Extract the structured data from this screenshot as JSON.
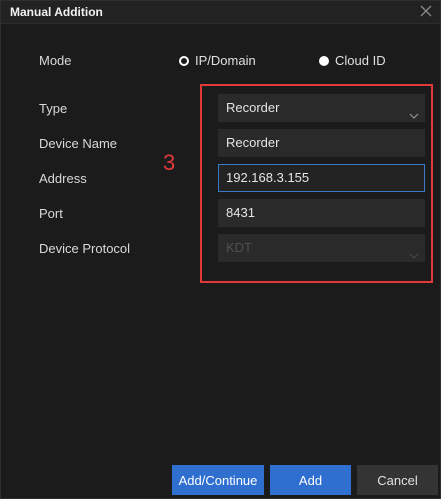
{
  "dialog": {
    "title": "Manual Addition",
    "close_icon": "close-icon"
  },
  "mode": {
    "label": "Mode",
    "options": [
      {
        "label": "IP/Domain",
        "selected": true
      },
      {
        "label": "Cloud ID",
        "selected": false
      }
    ]
  },
  "form": {
    "type": {
      "label": "Type",
      "value": "Recorder"
    },
    "device_name": {
      "label": "Device Name",
      "value": "Recorder"
    },
    "address": {
      "label": "Address",
      "value": "192.168.3.155"
    },
    "port": {
      "label": "Port",
      "value": "8431"
    },
    "device_protocol": {
      "label": "Device Protocol",
      "value": "KDT"
    }
  },
  "annotation": {
    "number": "3",
    "color": "#e23a3a"
  },
  "buttons": {
    "add_continue": "Add/Continue",
    "add": "Add",
    "cancel": "Cancel"
  },
  "colors": {
    "accent": "#2f6fd0",
    "background": "#1b1b1b"
  }
}
